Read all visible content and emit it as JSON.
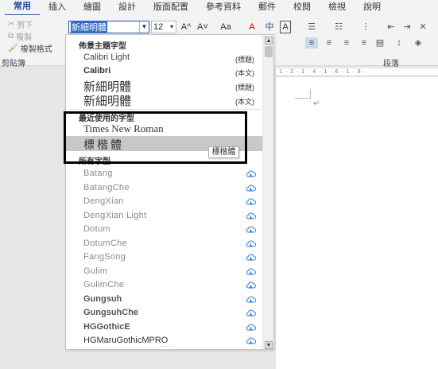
{
  "ribbon": {
    "tabs": [
      "常用",
      "插入",
      "繪圖",
      "設計",
      "版面配置",
      "參考資料",
      "郵件",
      "校閱",
      "檢視",
      "說明"
    ],
    "active_tab": "常用",
    "clipboard": {
      "cut": "剪下",
      "copy": "複製",
      "format_painter": "複製格式",
      "group_label": "剪貼簿"
    },
    "font": {
      "name_value": "新細明體",
      "size_value": "12",
      "grow": "A^",
      "shrink": "A˅",
      "case": "Aa",
      "clear": "A",
      "phonetic": "中",
      "border": "A"
    },
    "paragraph_label": "段落"
  },
  "dropdown": {
    "theme_header": "佈景主題字型",
    "theme_fonts": [
      {
        "name": "Calibri Light",
        "tag": "(標題)"
      },
      {
        "name": "Calibri",
        "tag": "(本文)"
      },
      {
        "name": "新細明體",
        "tag": "(標題)"
      },
      {
        "name": "新細明體",
        "tag": "(本文)"
      }
    ],
    "recent_header": "最近使用的字型",
    "recent_fonts": [
      "Times New Roman",
      "標楷體"
    ],
    "all_header": "所有字型",
    "all_fonts": [
      "Batang",
      "BatangChe",
      "DengXian",
      "DengXian Light",
      "Dotum",
      "DotumChe",
      "FangSong",
      "Gulim",
      "GulimChe",
      "Gungsuh",
      "GungsuhChe",
      "HGGothicE",
      "HGMaruGothicMPRO"
    ],
    "tooltip": "標楷體",
    "resize_handle": "....."
  },
  "document": {
    "ruler": "1 · 2 · 1 · 4 · 1 · 6 · 1 · 8 ·",
    "paragraph_mark": "↵"
  },
  "colors": {
    "accent": "#2b579a",
    "highlight": "#c8c8c8",
    "annotation": "#000000"
  }
}
